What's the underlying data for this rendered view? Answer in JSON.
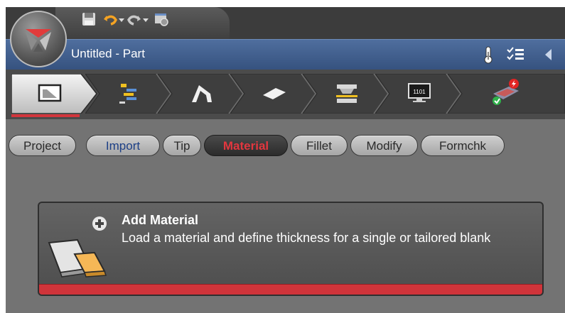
{
  "app": {
    "title": "Untitled - Part"
  },
  "workflow": {
    "steps": [
      {
        "name": "part-setup",
        "active": true
      },
      {
        "name": "tree"
      },
      {
        "name": "forming"
      },
      {
        "name": "blank"
      },
      {
        "name": "die"
      },
      {
        "name": "output-1101"
      },
      {
        "name": "check"
      }
    ],
    "output_text": "1101"
  },
  "subtabs": [
    {
      "label": "Project"
    },
    {
      "label": "Import"
    },
    {
      "label": "Tip"
    },
    {
      "label": "Material",
      "active": true
    },
    {
      "label": "Fillet"
    },
    {
      "label": "Modify"
    },
    {
      "label": "Formchk"
    }
  ],
  "card": {
    "title": "Add Material",
    "description": "Load a material and define thickness for a single or tailored blank"
  },
  "colors": {
    "accent_red": "#d0343a",
    "titlebar_blue": "#3f5d8c"
  }
}
